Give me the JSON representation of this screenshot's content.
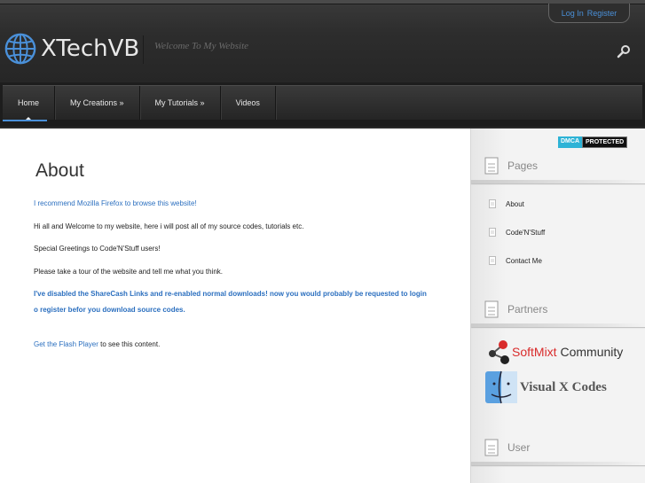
{
  "header": {
    "login_label": "Log In",
    "register_label": "Register",
    "logo_text": "XTechVB",
    "tagline": "Welcome To My Website",
    "search_icon": "search-icon"
  },
  "nav": {
    "items": [
      {
        "label": "Home",
        "active": true
      },
      {
        "label": "My Creations »"
      },
      {
        "label": "My Tutorials »"
      },
      {
        "label": "Videos"
      }
    ]
  },
  "main": {
    "title": "About",
    "line1": "I recommend Mozilla Firefox to browse this website!",
    "line2": "Hi all and Welcome to my website, here i will post all of my source codes, tutorials etc.",
    "line3": "Special Greetings to Code'N'Stuff users!",
    "line4": "Please take a tour of the website and tell me what you think.",
    "line5a": "I've disabled the ShareCash Links and re-enabled normal downloads! now you would probably be requested to login",
    "line5b": "o register befor you download source codes.",
    "flash_link": "Get the Flash Player",
    "flash_rest": " to see this content."
  },
  "sidebar": {
    "dmca_a": "DMCA",
    "dmca_b": "PROTECTED",
    "pages_title": "Pages",
    "pages": [
      {
        "label": "About"
      },
      {
        "label": "Code'N'Stuff"
      },
      {
        "label": "Contact Me"
      }
    ],
    "partners_title": "Partners",
    "softmixt_a": "Soft",
    "softmixt_b": "Mixt",
    "softmixt_c": " Community",
    "vxc": "Visual X Codes",
    "user_title": "User"
  },
  "colors": {
    "accent": "#2b6fbf",
    "header_bg": "#2d2d2d",
    "sidebar_bg": "#f3f3f3"
  }
}
